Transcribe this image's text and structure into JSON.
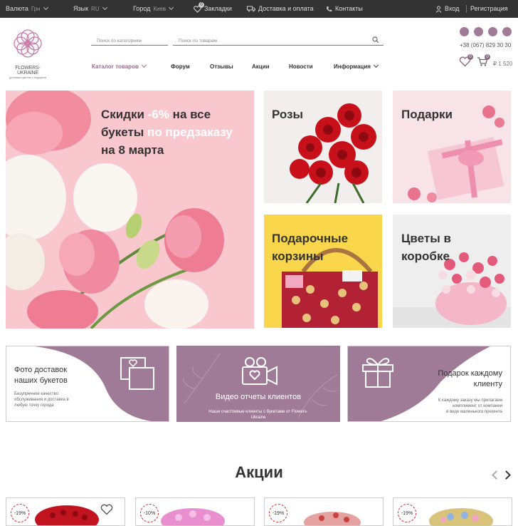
{
  "topbar": {
    "currency_label": "Валюта",
    "currency_value": "Грн",
    "language_label": "Язык",
    "language_value": "RU",
    "city_label": "Город",
    "city_value": "Киев",
    "bookmarks_label": "Закладки",
    "bookmarks_count": "0",
    "delivery_label": "Доставка и оплата",
    "contacts_label": "Контакты",
    "login_label": "Вход",
    "register_label": "Регистрация"
  },
  "logo": {
    "name": "FLOWERS-UKRAINE",
    "tagline": "доставка цветов и подарков"
  },
  "search": {
    "category_placeholder": "Поиск по категориям",
    "product_placeholder": "Поиск по товарам"
  },
  "nav": {
    "catalog": "Каталог товаров",
    "forum": "Форум",
    "reviews": "Отзывы",
    "promos": "Акции",
    "news": "Новости",
    "info": "Информация"
  },
  "contact": {
    "phone": "+38 (067) 829 30 30",
    "wishlist_count": "0",
    "cart_count": "0",
    "cart_total": "₽ 1 520"
  },
  "hero": {
    "line1_a": "Скидки ",
    "line1_b": "-6%",
    "line1_c": " на все",
    "line2_a": "букеты ",
    "line2_b": "по предзаказу",
    "line3": "на 8 марта"
  },
  "tiles": {
    "roses": "Розы",
    "gifts": "Подарки",
    "baskets_1": "Подарочные",
    "baskets_2": "корзины",
    "box_1": "Цветы в",
    "box_2": "коробке"
  },
  "banners": {
    "photo_title_1": "Фото доставок",
    "photo_title_2": "наших букетов",
    "photo_sub_1": "Безупречное качество",
    "photo_sub_2": "обслуживания и доставка в",
    "photo_sub_3": "любую точку города",
    "video_title": "Видео отчеты клиентов",
    "video_sub_1": "Наши счастливые клиенты с букетами от Flowers-",
    "video_sub_2": "Ukraine",
    "gift_title_1": "Подарок каждому",
    "gift_title_2": "клиенту",
    "gift_sub_1": "К каждому заказу мы прилагаем",
    "gift_sub_2": "комплимент от компании",
    "gift_sub_3": "в виде маленького презента"
  },
  "promos_section": {
    "title": "Акции",
    "cards": [
      {
        "discount": "-19%"
      },
      {
        "discount": "-10%"
      },
      {
        "discount": "-19%"
      },
      {
        "discount": "-19%"
      }
    ]
  },
  "colors": {
    "brand": "#9a6a8c",
    "banner": "#a07b97",
    "topbar": "#333333",
    "accent_text": "#f0a1b8"
  }
}
